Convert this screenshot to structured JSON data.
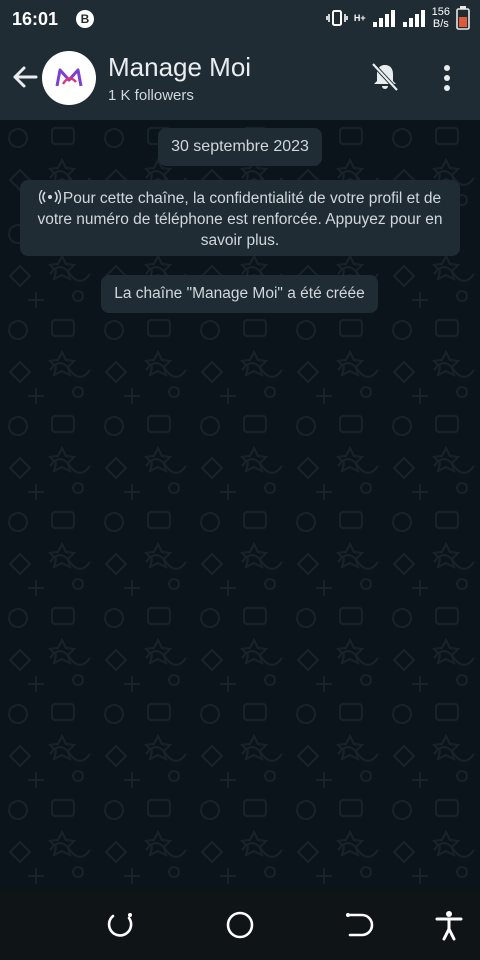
{
  "status": {
    "time": "16:01",
    "b_badge": "B",
    "net_speed_value": "156",
    "net_speed_unit": "B/s",
    "network": "H+"
  },
  "header": {
    "title": "Manage Moi",
    "subtitle": "1 K followers"
  },
  "chat": {
    "date": "30 septembre 2023",
    "privacy_notice": "Pour cette chaîne, la confidentialité de votre profil et de votre numéro de téléphone est renforcée. Appuyez pour en savoir plus.",
    "created_notice": "La chaîne \"Manage Moi\" a été créée"
  },
  "icons": {
    "back": "arrow-left-icon",
    "mute": "bell-off-icon",
    "more": "more-vert-icon",
    "broadcast": "broadcast-icon",
    "nav_recents": "recents-icon",
    "nav_home": "home-icon",
    "nav_back": "back-icon",
    "accessibility": "accessibility-icon"
  },
  "colors": {
    "header_bg": "#1f2c34",
    "chat_bg": "#0b141a",
    "bubble_bg": "#1f2c34",
    "logo_accent": "#7b3fd1"
  }
}
